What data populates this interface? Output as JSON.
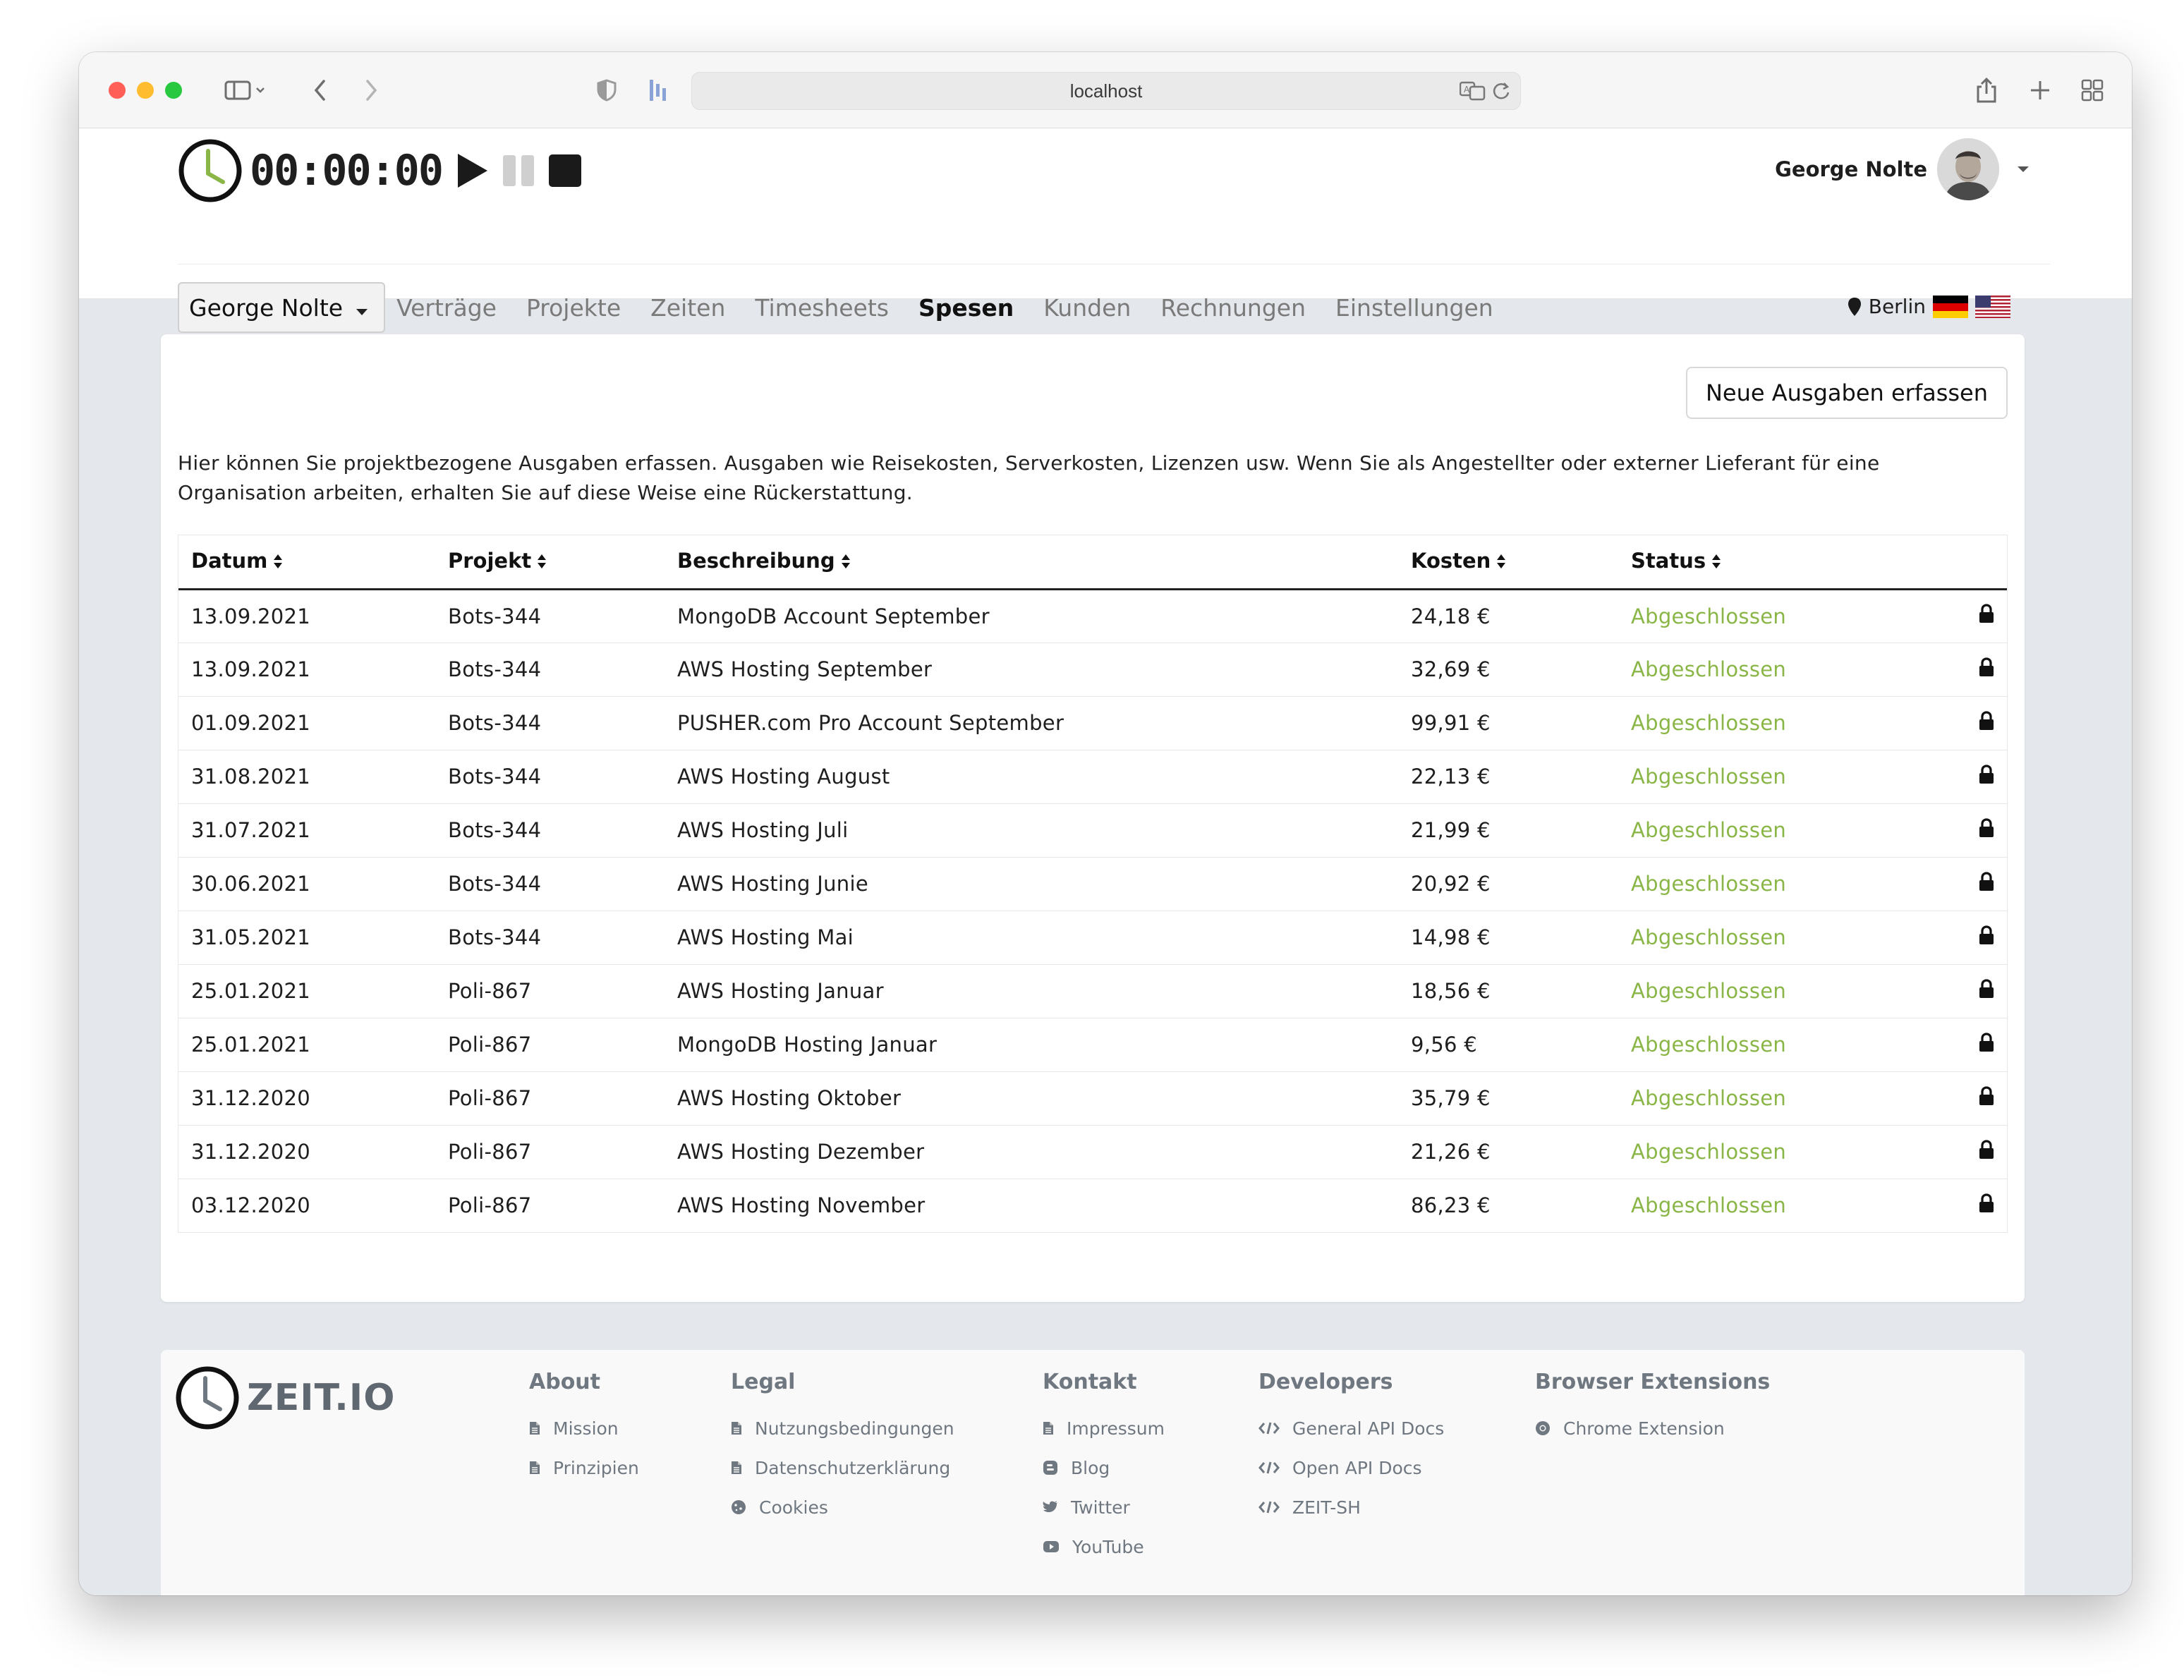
{
  "browser": {
    "url": "localhost"
  },
  "timer": {
    "display": "00:00:00"
  },
  "user": {
    "name": "George Nolte"
  },
  "nav": {
    "selector": "George Nolte",
    "items": [
      {
        "label": "Verträge",
        "active": false
      },
      {
        "label": "Projekte",
        "active": false
      },
      {
        "label": "Zeiten",
        "active": false
      },
      {
        "label": "Timesheets",
        "active": false
      },
      {
        "label": "Spesen",
        "active": true
      },
      {
        "label": "Kunden",
        "active": false
      },
      {
        "label": "Rechnungen",
        "active": false
      },
      {
        "label": "Einstellungen",
        "active": false
      }
    ],
    "location": "Berlin"
  },
  "main": {
    "new_button": "Neue Ausgaben erfassen",
    "intro": "Hier können Sie projektbezogene Ausgaben erfassen. Ausgaben wie Reisekosten, Serverkosten, Lizenzen usw. Wenn Sie als Angestellter oder externer Lieferant für eine Organisation arbeiten, erhalten Sie auf diese Weise eine Rückerstattung.",
    "columns": [
      "Datum",
      "Projekt",
      "Beschreibung",
      "Kosten",
      "Status"
    ],
    "rows": [
      {
        "date": "13.09.2021",
        "project": "Bots-344",
        "description": "MongoDB Account September",
        "cost": "24,18 €",
        "status": "Abgeschlossen"
      },
      {
        "date": "13.09.2021",
        "project": "Bots-344",
        "description": "AWS Hosting September",
        "cost": "32,69 €",
        "status": "Abgeschlossen"
      },
      {
        "date": "01.09.2021",
        "project": "Bots-344",
        "description": "PUSHER.com Pro Account September",
        "cost": "99,91 €",
        "status": "Abgeschlossen"
      },
      {
        "date": "31.08.2021",
        "project": "Bots-344",
        "description": "AWS Hosting August",
        "cost": "22,13 €",
        "status": "Abgeschlossen"
      },
      {
        "date": "31.07.2021",
        "project": "Bots-344",
        "description": "AWS Hosting Juli",
        "cost": "21,99 €",
        "status": "Abgeschlossen"
      },
      {
        "date": "30.06.2021",
        "project": "Bots-344",
        "description": "AWS Hosting Junie",
        "cost": "20,92 €",
        "status": "Abgeschlossen"
      },
      {
        "date": "31.05.2021",
        "project": "Bots-344",
        "description": "AWS Hosting Mai",
        "cost": "14,98 €",
        "status": "Abgeschlossen"
      },
      {
        "date": "25.01.2021",
        "project": "Poli-867",
        "description": "AWS Hosting Januar",
        "cost": "18,56 €",
        "status": "Abgeschlossen"
      },
      {
        "date": "25.01.2021",
        "project": "Poli-867",
        "description": "MongoDB Hosting Januar",
        "cost": "9,56 €",
        "status": "Abgeschlossen"
      },
      {
        "date": "31.12.2020",
        "project": "Poli-867",
        "description": "AWS Hosting Oktober",
        "cost": "35,79 €",
        "status": "Abgeschlossen"
      },
      {
        "date": "31.12.2020",
        "project": "Poli-867",
        "description": "AWS Hosting Dezember",
        "cost": "21,26 €",
        "status": "Abgeschlossen"
      },
      {
        "date": "03.12.2020",
        "project": "Poli-867",
        "description": "AWS Hosting November",
        "cost": "86,23 €",
        "status": "Abgeschlossen"
      }
    ]
  },
  "footer": {
    "brand": "ZEIT.IO",
    "columns": [
      {
        "title": "About",
        "links": [
          {
            "label": "Mission",
            "icon": "file-icon"
          },
          {
            "label": "Prinzipien",
            "icon": "file-icon"
          }
        ]
      },
      {
        "title": "Legal",
        "links": [
          {
            "label": "Nutzungsbedingungen",
            "icon": "file-icon"
          },
          {
            "label": "Datenschutzerklärung",
            "icon": "file-icon"
          },
          {
            "label": "Cookies",
            "icon": "cookie-icon"
          }
        ]
      },
      {
        "title": "Kontakt",
        "links": [
          {
            "label": "Impressum",
            "icon": "file-icon"
          },
          {
            "label": "Blog",
            "icon": "blog-icon"
          },
          {
            "label": "Twitter",
            "icon": "twitter-icon"
          },
          {
            "label": "YouTube",
            "icon": "youtube-icon"
          }
        ]
      },
      {
        "title": "Developers",
        "links": [
          {
            "label": "General API Docs",
            "icon": "code-icon"
          },
          {
            "label": "Open API Docs",
            "icon": "code-icon"
          },
          {
            "label": "ZEIT-SH",
            "icon": "code-icon"
          }
        ]
      },
      {
        "title": "Browser Extensions",
        "links": [
          {
            "label": "Chrome Extension",
            "icon": "chrome-icon"
          }
        ]
      }
    ]
  },
  "colors": {
    "status_done": "#8ab647",
    "clock_hand": "#8ab647",
    "footer_text": "#6f7780"
  }
}
